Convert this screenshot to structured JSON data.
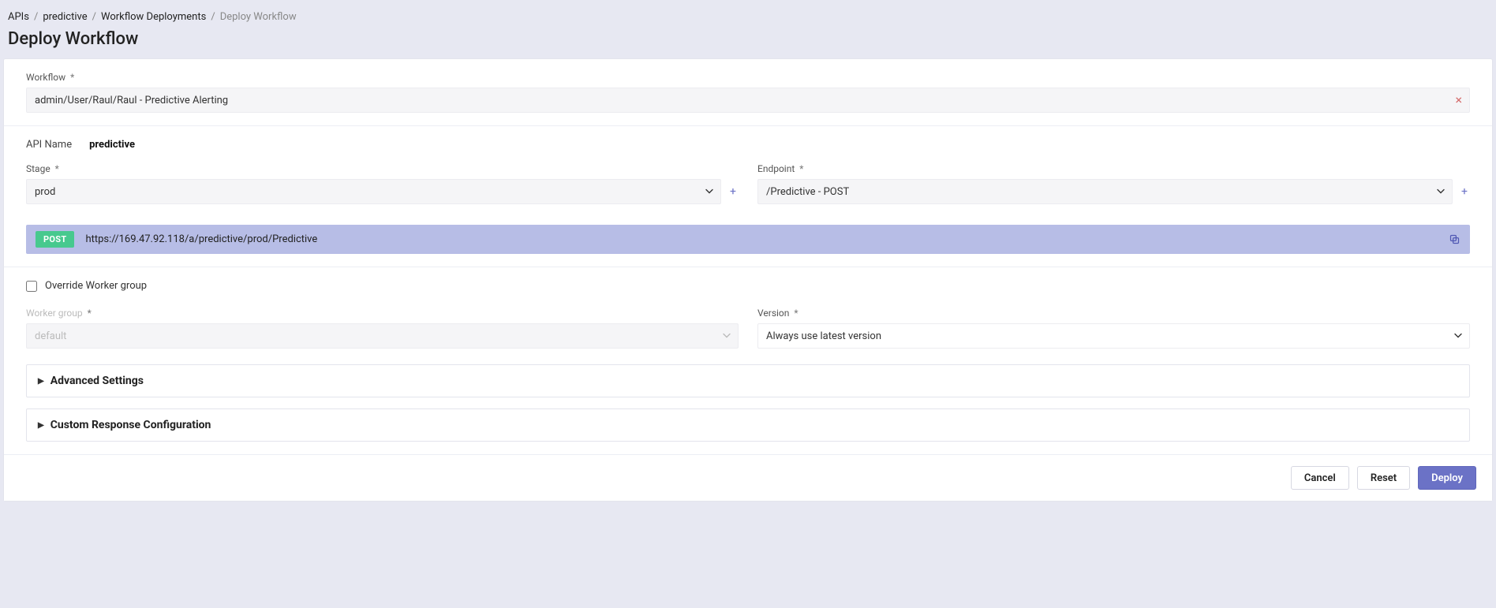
{
  "breadcrumb": {
    "items": [
      "APIs",
      "predictive",
      "Workflow Deployments"
    ],
    "current": "Deploy Workflow"
  },
  "page_title": "Deploy Workflow",
  "workflow": {
    "label": "Workflow",
    "value": "admin/User/Raul/Raul - Predictive Alerting"
  },
  "api": {
    "name_label": "API Name",
    "name_value": "predictive",
    "stage_label": "Stage",
    "stage_value": "prod",
    "endpoint_label": "Endpoint",
    "endpoint_value": "/Predictive - POST",
    "method": "POST",
    "url": "https://169.47.92.118/a/predictive/prod/Predictive"
  },
  "worker": {
    "override_label": "Override Worker group",
    "group_label": "Worker group",
    "group_value": "default",
    "version_label": "Version",
    "version_value": "Always use latest version"
  },
  "accordions": {
    "advanced": "Advanced Settings",
    "response": "Custom Response Configuration"
  },
  "buttons": {
    "cancel": "Cancel",
    "reset": "Reset",
    "deploy": "Deploy"
  }
}
